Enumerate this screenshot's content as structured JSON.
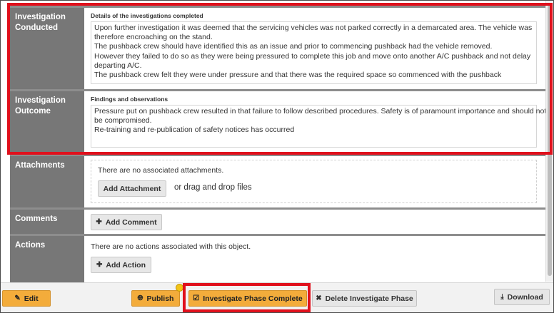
{
  "sections": {
    "investigation_conducted": {
      "label_line1": "Investigation",
      "label_line2": "Conducted",
      "sub_heading": "Details of the investigations completed",
      "lines": [
        "Upon further investigation it was deemed that the servicing vehicles was not parked correctly in a demarcated area. The vehicle was",
        "therefore encroaching on the stand.",
        "The pushback crew should have identified this as an issue and prior to commencing pushback had the vehicle removed.",
        "However they failed to do so as they were being pressured to complete this job and move onto another A/C pushback and not delay",
        "departing A/C.",
        "The pushback crew felt they were under pressure and that there was the required space so commenced with the pushback"
      ]
    },
    "investigation_outcome": {
      "label_line1": "Investigation",
      "label_line2": "Outcome",
      "sub_heading": "Findings and observations",
      "lines": [
        "Pressure put on pushback crew resulted in that failure to follow described procedures. Safety is of paramount importance and should not",
        "be compromised.",
        "Re-training and re-publication of safety notices has occurred"
      ]
    },
    "attachments": {
      "label": "Attachments",
      "empty_text": "There are no associated attachments.",
      "add_button": "Add Attachment",
      "drop_text": "or drag and drop files"
    },
    "comments": {
      "label": "Comments",
      "add_button": "Add Comment"
    },
    "actions": {
      "label": "Actions",
      "empty_text": "There are no actions associated with this object.",
      "add_button": "Add Action"
    }
  },
  "footer": {
    "edit": "Edit",
    "publish": "Publish",
    "investigate_complete": "Investigate Phase Complete",
    "delete_phase": "Delete Investigate Phase",
    "download": "Download"
  },
  "colors": {
    "side_panel": "#777777",
    "accent_orange": "#f3ac3b",
    "highlight_red": "#e0101c"
  },
  "icons": {
    "edit": "edit-icon",
    "publish": "globe-icon",
    "investigate_complete": "check-square-icon",
    "delete_phase": "close-icon",
    "download": "download-icon",
    "add": "plus-icon"
  }
}
